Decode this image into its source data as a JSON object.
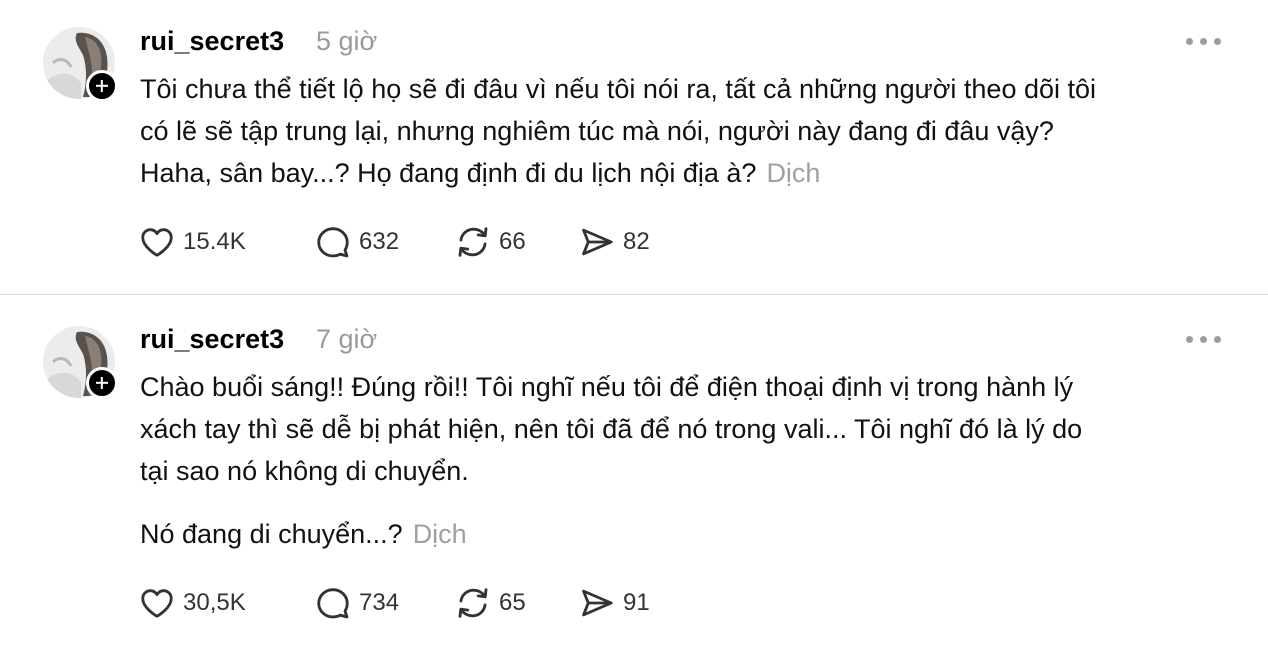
{
  "posts": [
    {
      "username": "rui_secret3",
      "time": "5 giờ",
      "paragraphs": [
        {
          "lines": [
            "Tôi chưa thể tiết lộ họ sẽ đi đâu vì nếu tôi nói ra, tất cả những người theo dõi tôi",
            "có lẽ sẽ tập trung lại, nhưng nghiêm túc mà nói, người này đang đi đâu vậy?",
            "Haha, sân bay...? Họ đang định đi du lịch nội địa à?"
          ]
        }
      ],
      "translate_label": "Dịch",
      "stats": {
        "likes": "15.4K",
        "replies": "632",
        "reposts": "66",
        "shares": "82"
      }
    },
    {
      "username": "rui_secret3",
      "time": "7 giờ",
      "paragraphs": [
        {
          "lines": [
            "Chào buổi sáng!! Đúng rồi!! Tôi nghĩ nếu tôi để điện thoại định vị trong hành lý",
            "xách tay thì sẽ dễ bị phát hiện, nên tôi đã để nó trong vali... Tôi nghĩ đó là lý do",
            "tại sao nó không di chuyển."
          ]
        },
        {
          "lines": [
            "Nó đang di chuyển...?"
          ]
        }
      ],
      "translate_label": "Dịch",
      "stats": {
        "likes": "30,5K",
        "replies": "734",
        "reposts": "65",
        "shares": "91"
      }
    }
  ],
  "icons": {
    "like": "heart-icon",
    "reply": "comment-bubble-icon",
    "repost": "repost-arrows-icon",
    "share": "send-icon",
    "more": "more-horizontal-icon",
    "follow": "plus-icon"
  },
  "colors": {
    "text": "#111111",
    "muted": "#9a9a9a",
    "divider": "#d9d9d9",
    "icon": "#333333"
  }
}
